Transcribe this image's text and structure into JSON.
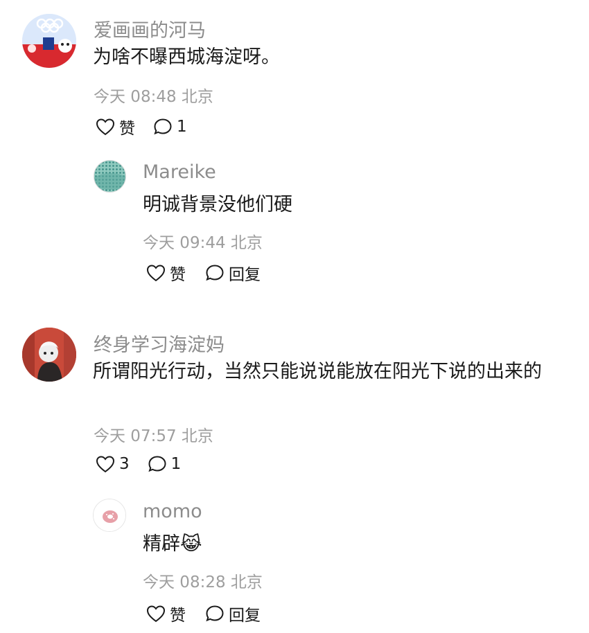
{
  "comments": [
    {
      "username": "爱画画的河马",
      "text": "为啥不曝西城海淀呀。",
      "time": "今天 08:48 北京",
      "like_label": "赞",
      "reply_count": "1",
      "avatar_icon": "olympic-mascot-avatar",
      "replies": [
        {
          "username": "Mareike",
          "text": "明诚背景没他们硬",
          "time": "今天 09:44 北京",
          "like_label": "赞",
          "reply_label": "回复",
          "avatar_icon": "green-pattern-avatar"
        }
      ]
    },
    {
      "username": "终身学习海淀妈",
      "text": "所谓阳光行动，当然只能说说能放在阳光下说的出来的",
      "time": "今天 07:57 北京",
      "like_label": "3",
      "reply_count": "1",
      "avatar_icon": "character-avatar",
      "replies": [
        {
          "username": "momo",
          "text": "精辟😹",
          "time": "今天 08:28 北京",
          "like_label": "赞",
          "reply_label": "回复",
          "avatar_icon": "donut-avatar"
        }
      ]
    }
  ],
  "colors": {
    "name": "#8c8c8c",
    "meta": "#9e9e9e",
    "text": "#1a1a1a"
  }
}
